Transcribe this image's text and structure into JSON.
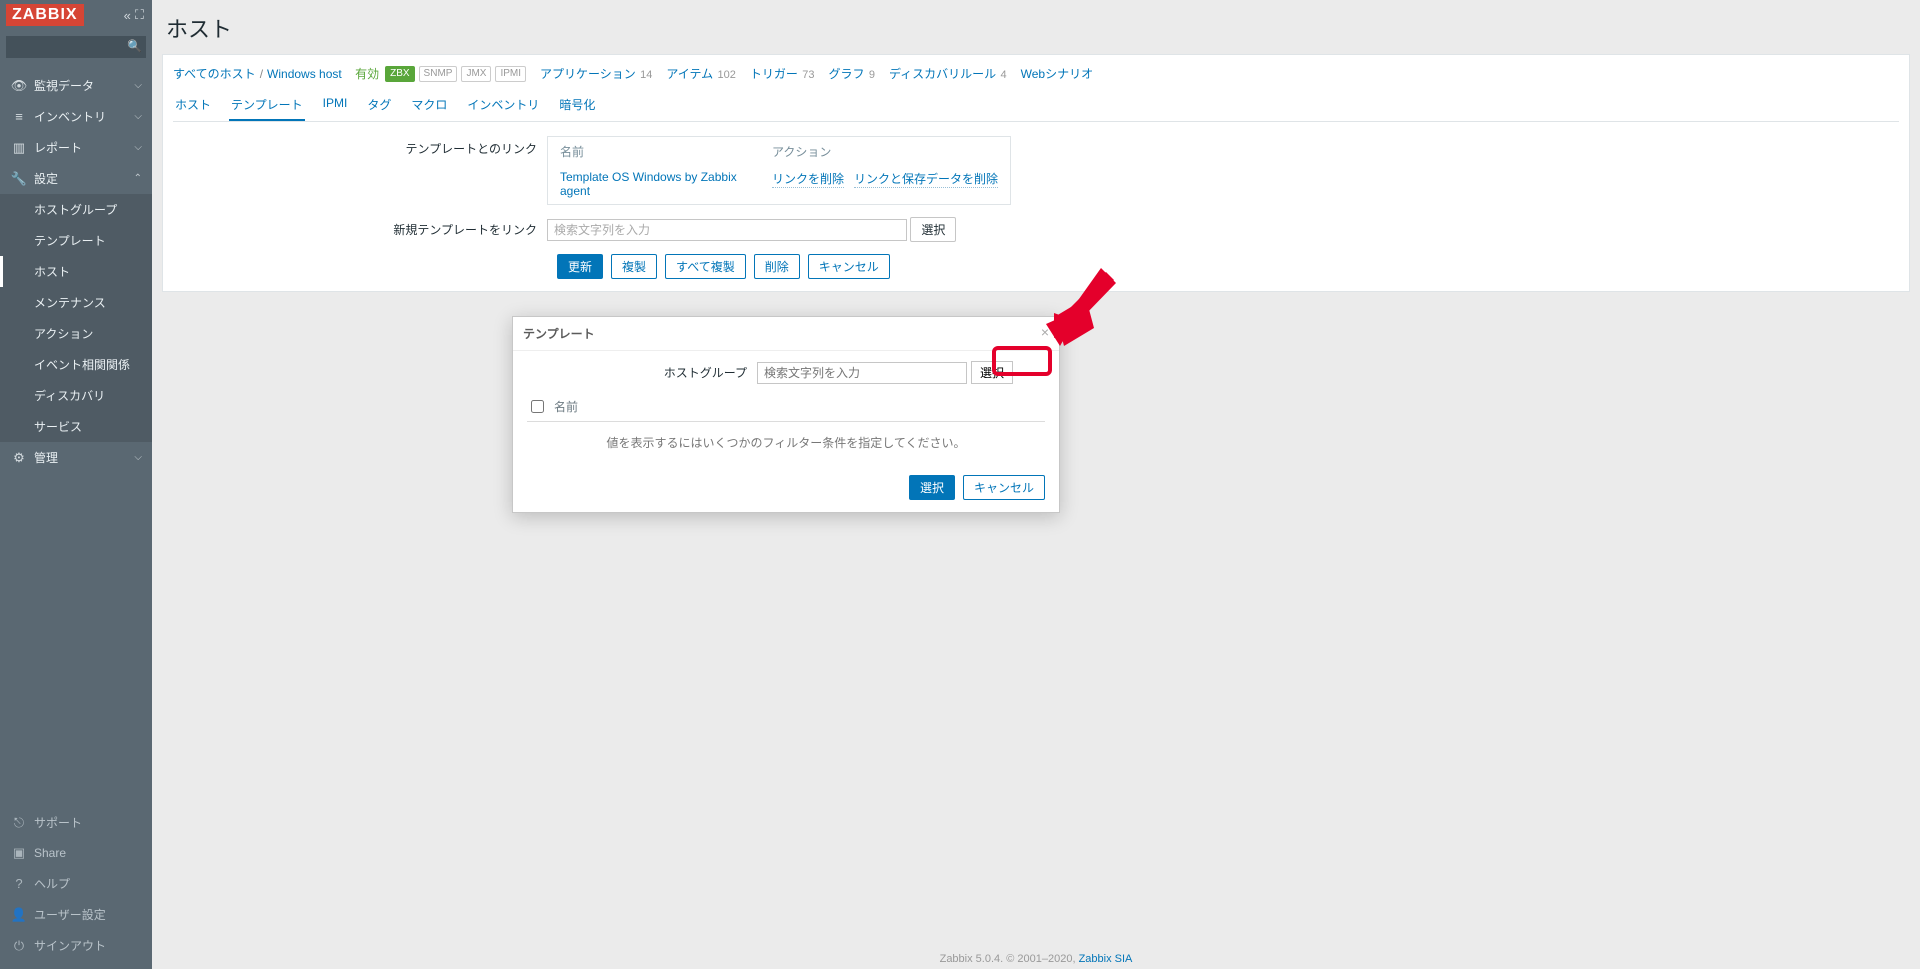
{
  "brand": "ZABBIX",
  "search": {
    "placeholder": ""
  },
  "sidebar": {
    "main": [
      {
        "icon": "◉",
        "label": "監視データ"
      },
      {
        "icon": "≡",
        "label": "インベントリ"
      },
      {
        "icon": "▥",
        "label": "レポート"
      },
      {
        "icon": "🔧",
        "label": "設定",
        "expanded": true,
        "children": [
          {
            "label": "ホストグループ"
          },
          {
            "label": "テンプレート"
          },
          {
            "label": "ホスト",
            "active": true
          },
          {
            "label": "メンテナンス"
          },
          {
            "label": "アクション"
          },
          {
            "label": "イベント相関関係"
          },
          {
            "label": "ディスカバリ"
          },
          {
            "label": "サービス"
          }
        ]
      },
      {
        "icon": "⚙",
        "label": "管理"
      }
    ],
    "bottom": [
      {
        "icon": "⎋",
        "label": "サポート"
      },
      {
        "icon": "▣",
        "label": "Share"
      },
      {
        "icon": "?",
        "label": "ヘルプ"
      },
      {
        "icon": "👤",
        "label": "ユーザー設定"
      },
      {
        "icon": "⏻",
        "label": "サインアウト"
      }
    ]
  },
  "page": {
    "title": "ホスト",
    "breadcrumb": {
      "all_hosts": "すべてのホスト",
      "host": "Windows host"
    },
    "status": "有効",
    "badges": [
      "ZBX",
      "SNMP",
      "JMX",
      "IPMI"
    ],
    "links": [
      {
        "label": "アプリケーション",
        "count": "14"
      },
      {
        "label": "アイテム",
        "count": "102"
      },
      {
        "label": "トリガー",
        "count": "73"
      },
      {
        "label": "グラフ",
        "count": "9"
      },
      {
        "label": "ディスカバリルール",
        "count": "4"
      },
      {
        "label": "Webシナリオ",
        "count": ""
      }
    ],
    "tabs": [
      "ホスト",
      "テンプレート",
      "IPMI",
      "タグ",
      "マクロ",
      "インベントリ",
      "暗号化"
    ],
    "active_tab": 1,
    "form": {
      "linked_label": "テンプレートとのリンク",
      "table_headers": {
        "name": "名前",
        "action": "アクション"
      },
      "linked_template": "Template OS Windows by Zabbix agent",
      "action_unlink": "リンクを削除",
      "action_unlink_clear": "リンクと保存データを削除",
      "newlink_label": "新規テンプレートをリンク",
      "newlink_placeholder": "検索文字列を入力",
      "newlink_select": "選択"
    },
    "buttons": {
      "update": "更新",
      "clone": "複製",
      "full_clone": "すべて複製",
      "delete": "削除",
      "cancel": "キャンセル"
    }
  },
  "modal": {
    "title": "テンプレート",
    "hostgroup_label": "ホストグループ",
    "hostgroup_placeholder": "検索文字列を入力",
    "hostgroup_select": "選択",
    "col_name": "名前",
    "empty_msg": "値を表示するにはいくつかのフィルター条件を指定してください。",
    "btn_select": "選択",
    "btn_cancel": "キャンセル"
  },
  "footer": {
    "text": "Zabbix 5.0.4. © 2001–2020, ",
    "link": "Zabbix SIA"
  }
}
